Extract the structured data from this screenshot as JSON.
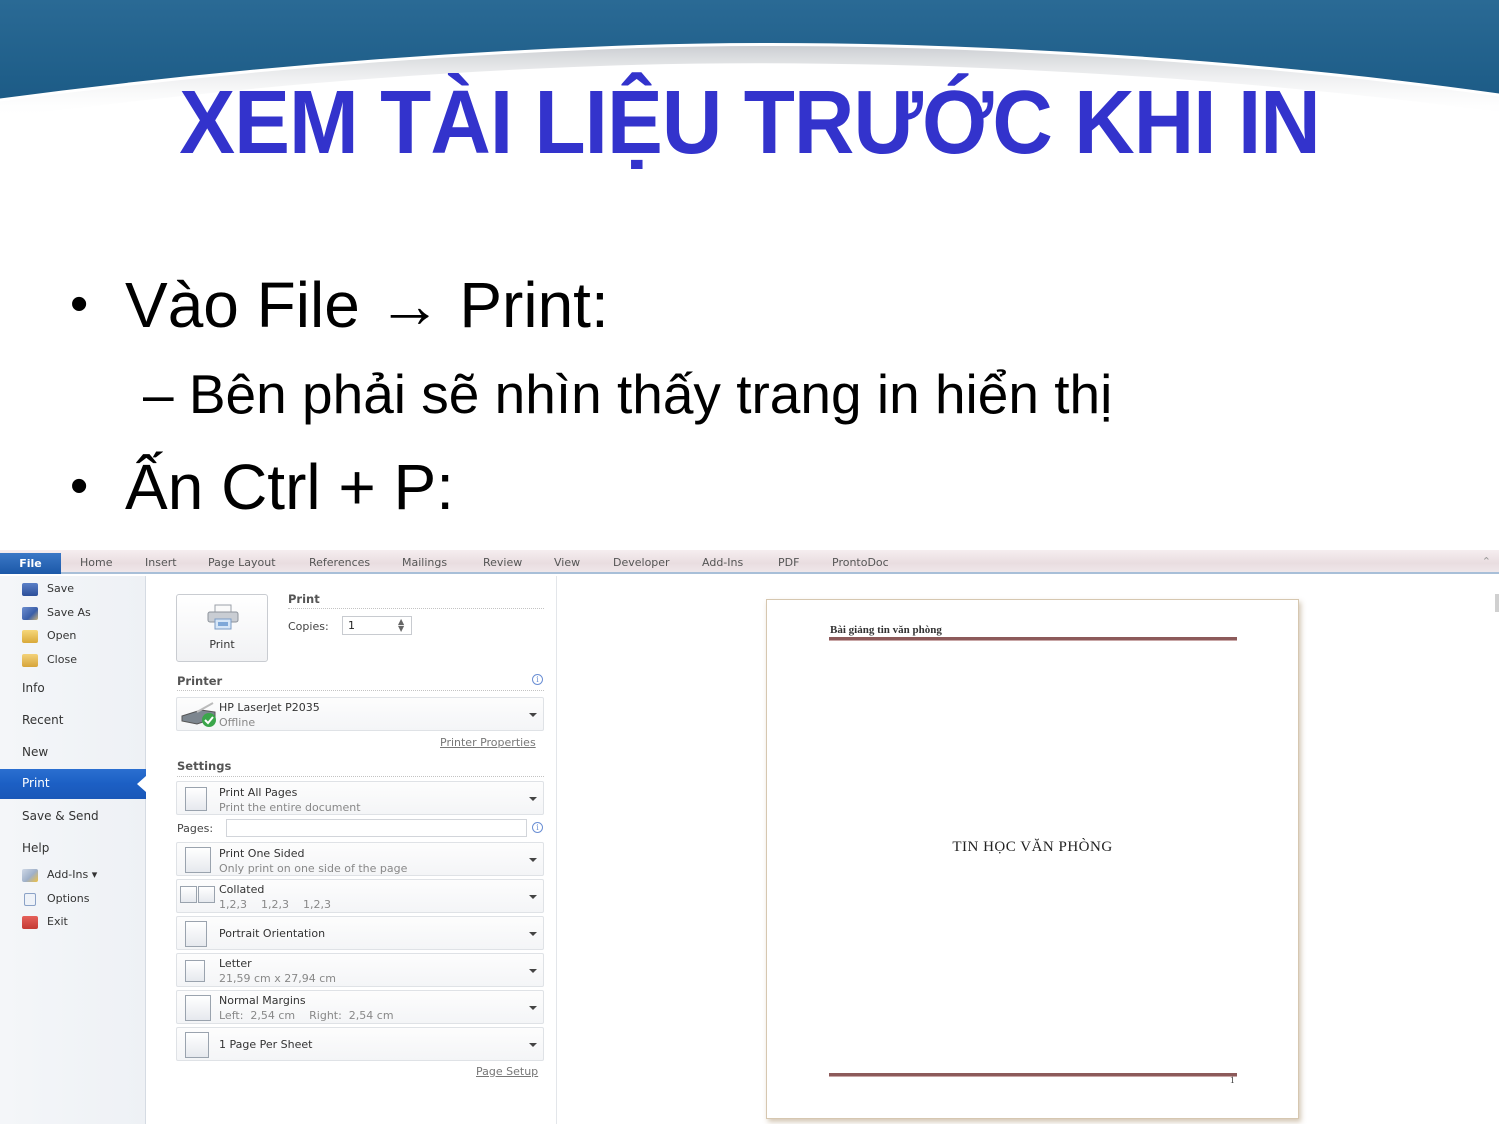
{
  "slide": {
    "title": "XEM TÀI LIỆU TRƯỚC KHI IN",
    "bullets": [
      {
        "text": "Vào File → Print:",
        "level": 1
      },
      {
        "text": "– Bên phải sẽ nhìn thấy trang in hiển thị",
        "level": 2
      },
      {
        "text": "Ấn Ctrl + P:",
        "level": 1
      }
    ],
    "bullet_glyph": "•",
    "colors": {
      "title": "#3333cc",
      "header_band": "#1f5f8b"
    }
  },
  "word": {
    "ribbon": {
      "file_tab": "File",
      "tabs": [
        "Home",
        "Insert",
        "Page Layout",
        "References",
        "Mailings",
        "Review",
        "View",
        "Developer",
        "Add-Ins",
        "PDF",
        "ProntoDoc"
      ],
      "minimize_glyph": "⌃"
    },
    "nav": {
      "quick": [
        {
          "label": "Save",
          "icon": "save-icon"
        },
        {
          "label": "Save As",
          "icon": "save-as-icon"
        },
        {
          "label": "Open",
          "icon": "open-folder-icon"
        },
        {
          "label": "Close",
          "icon": "close-folder-icon"
        }
      ],
      "sections": [
        "Info",
        "Recent",
        "New",
        "Print",
        "Save & Send",
        "Help"
      ],
      "active": "Print",
      "bottom": [
        {
          "label": "Add-Ins ▾",
          "icon": "add-ins-icon"
        },
        {
          "label": "Options",
          "icon": "options-icon"
        },
        {
          "label": "Exit",
          "icon": "exit-icon"
        }
      ]
    },
    "print": {
      "section_title": "Print",
      "button_label": "Print",
      "copies_label": "Copies:",
      "copies_value": "1",
      "printer_title": "Printer",
      "printer_name": "HP LaserJet P2035",
      "printer_status": "Offline",
      "printer_properties": "Printer Properties",
      "settings_title": "Settings",
      "pages_label": "Pages:",
      "pages_value": "",
      "settings": [
        {
          "title": "Print All Pages",
          "sub": "Print the entire document"
        },
        {
          "title": "Print One Sided",
          "sub": "Only print on one side of the page"
        },
        {
          "title": "Collated",
          "sub": "1,2,3    1,2,3    1,2,3"
        },
        {
          "title": "Portrait Orientation",
          "sub": ""
        },
        {
          "title": "Letter",
          "sub": "21,59 cm x 27,94 cm"
        },
        {
          "title": "Normal Margins",
          "sub": "Left:  2,54 cm    Right:  2,54 cm"
        },
        {
          "title": "1 Page Per Sheet",
          "sub": ""
        }
      ],
      "page_setup": "Page Setup"
    },
    "preview": {
      "header_text": "Bài giảng tin văn phòng",
      "doc_title": "TIN HỌC VĂN PHÒNG",
      "page_number": "1"
    }
  }
}
